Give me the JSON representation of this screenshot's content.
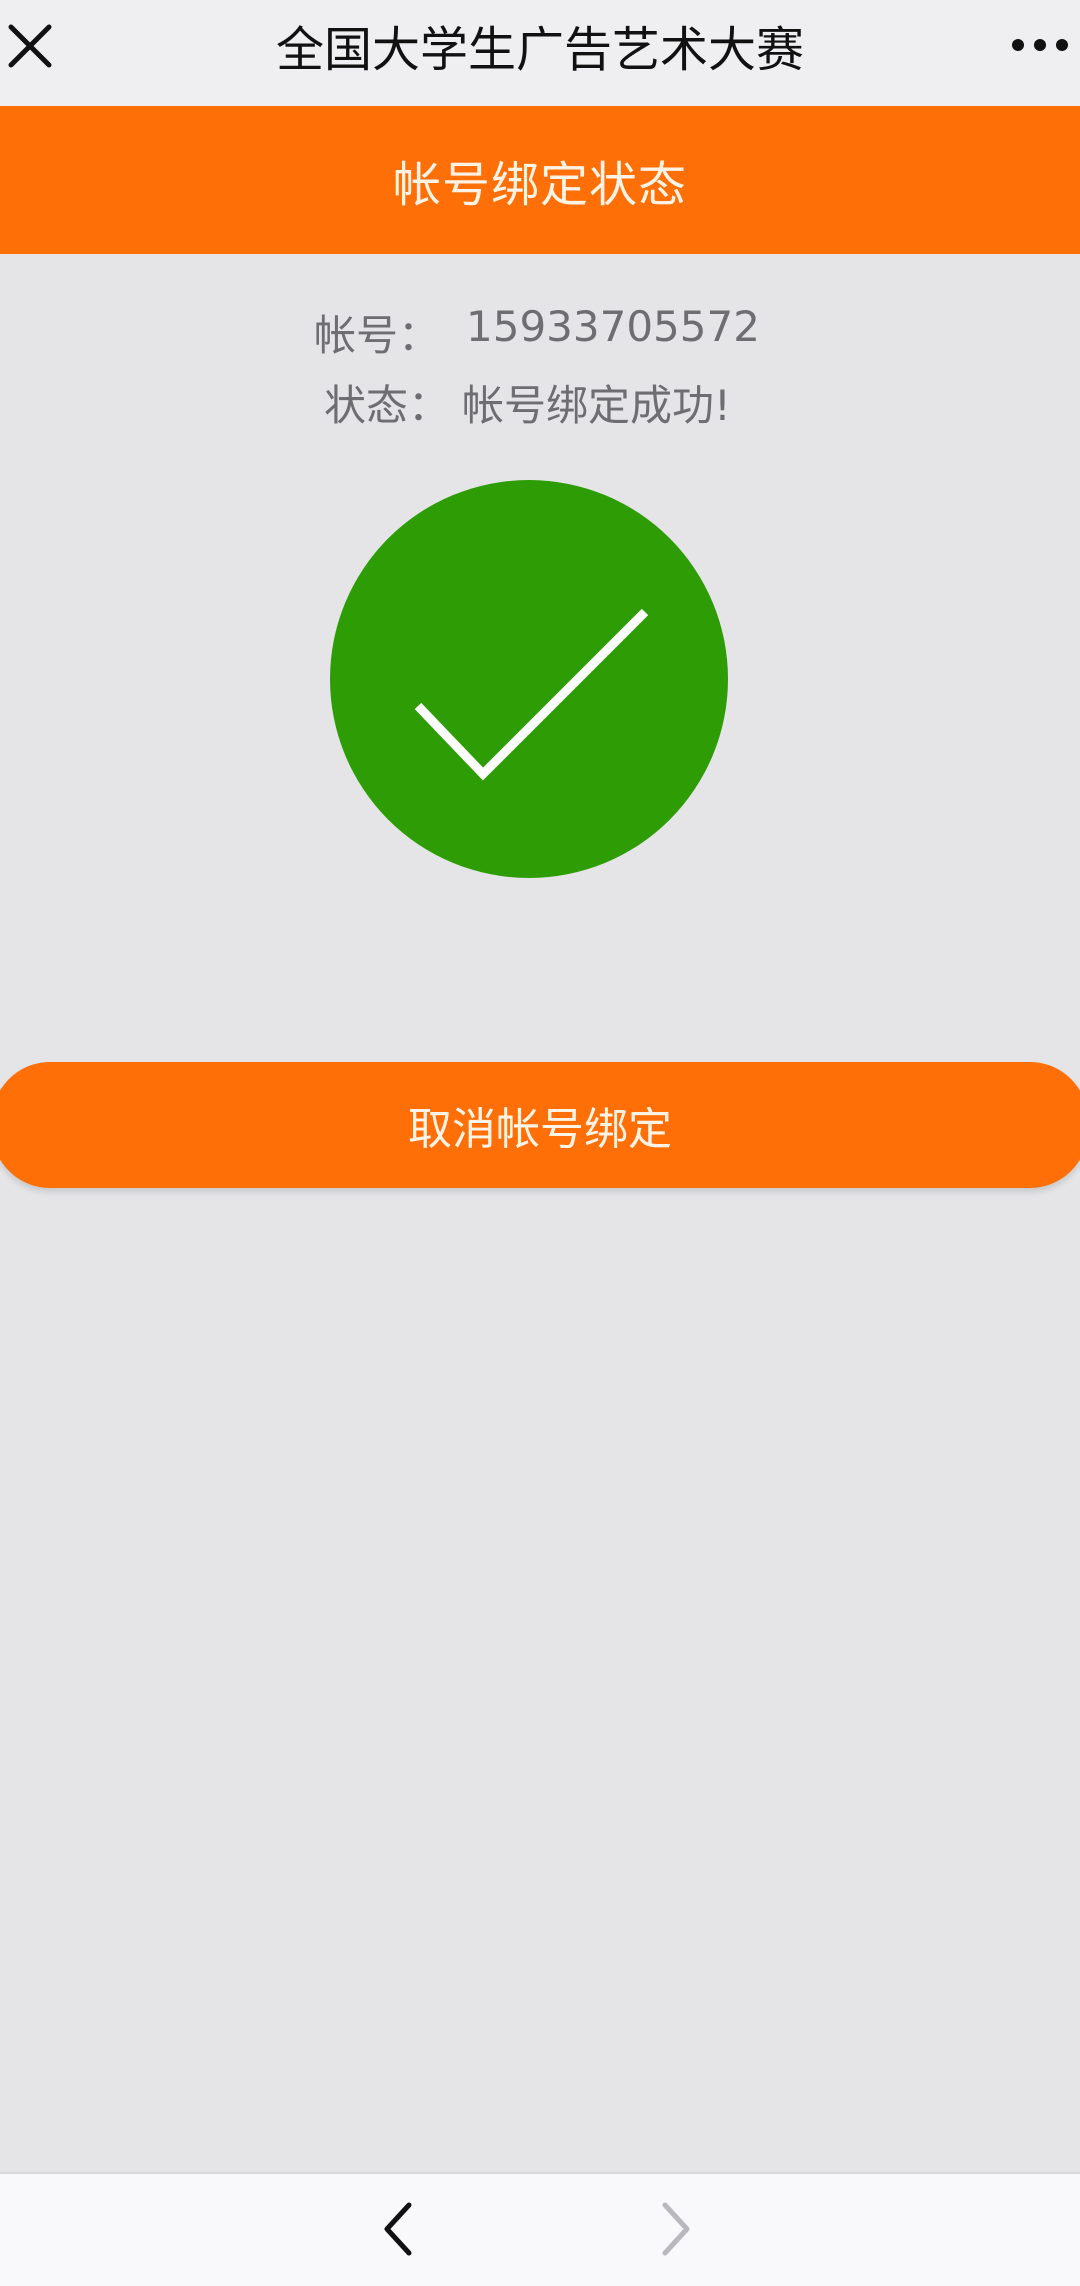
{
  "navbar": {
    "title": "全国大学生广告艺术大赛",
    "close_icon": "close-icon",
    "more_icon": "more-icon"
  },
  "header": {
    "title": "帐号绑定状态"
  },
  "account": {
    "label": "帐号：",
    "value": "15933705572"
  },
  "status": {
    "label": "状态：",
    "value": "帐号绑定成功!",
    "icon": "check-circle-icon"
  },
  "actions": {
    "unbind_label": "取消帐号绑定"
  },
  "toolbar": {
    "back_icon": "chevron-left-icon",
    "forward_icon": "chevron-right-icon"
  },
  "colors": {
    "accent": "#ff6f07",
    "success": "#2e9d05",
    "background": "#e5e4e7"
  }
}
